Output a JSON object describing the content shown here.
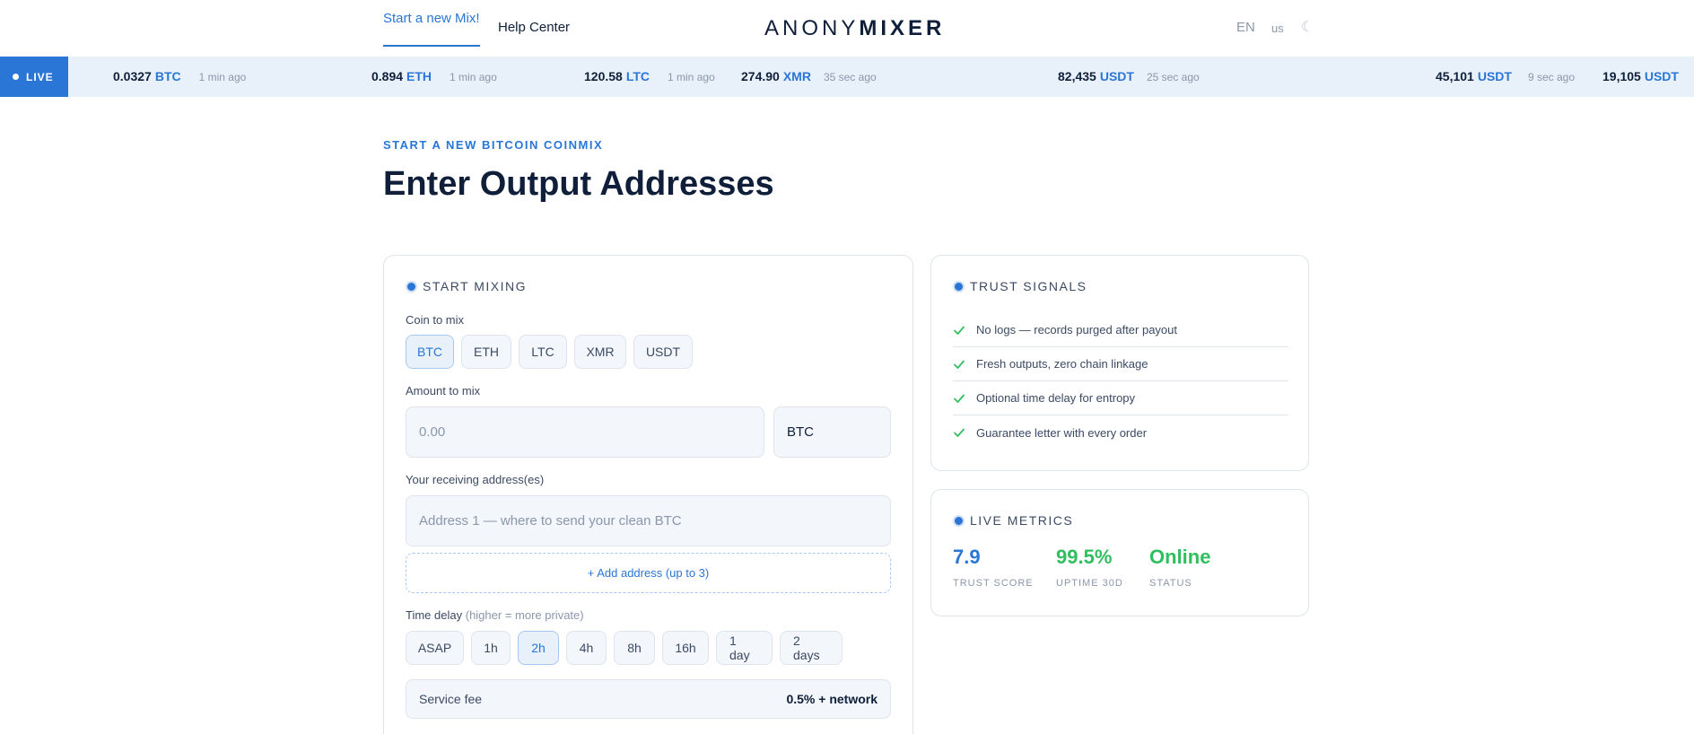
{
  "header": {
    "nav_active": "Start a new Mix!",
    "nav_help": "Help Center",
    "brand_light": "ANONY",
    "brand_bold": "MIXER",
    "lang": "EN",
    "region": "us",
    "theme_icon": "moon-icon",
    "theme_glyph": "☾"
  },
  "ticker": {
    "badge": "LIVE",
    "items": [
      {
        "amount": "0.0327",
        "coin": "BTC",
        "ago": "1 min ago"
      },
      {
        "amount": "0.894",
        "coin": "ETH",
        "ago": "1 min ago"
      },
      {
        "amount": "120.58",
        "coin": "LTC",
        "ago": "1 min ago"
      },
      {
        "amount": "274.90",
        "coin": "XMR",
        "ago": "35 sec ago"
      },
      {
        "amount": "82,435",
        "coin": "USDT",
        "ago": "25 sec ago"
      },
      {
        "amount": "45,101",
        "coin": "USDT",
        "ago": "9 sec ago"
      },
      {
        "amount": "19,105",
        "coin": "USDT",
        "ago": ""
      }
    ]
  },
  "page": {
    "eyebrow": "START A NEW BITCOIN COINMIX",
    "title": "Enter Output Addresses"
  },
  "mix_form": {
    "heading": "START MIXING",
    "coin_label": "Coin to mix",
    "coins": [
      "BTC",
      "ETH",
      "LTC",
      "XMR",
      "USDT"
    ],
    "selected_coin": "BTC",
    "amount_label": "Amount to mix",
    "amount_placeholder": "0.00",
    "amount_unit": "BTC",
    "address_label": "Your receiving address(es)",
    "address_placeholder": "Address 1 — where to send your clean BTC",
    "add_address": "+ Add address (up to 3)",
    "delay_label": "Time delay",
    "delay_hint": "(higher = more private)",
    "delays": [
      "ASAP",
      "1h",
      "2h",
      "4h",
      "8h",
      "16h",
      "1 day",
      "2 days"
    ],
    "selected_delay": "2h",
    "fee_label": "Service fee",
    "fee_value": "0.5% + network"
  },
  "trust": {
    "heading": "TRUST SIGNALS",
    "items": [
      "No logs — records purged after payout",
      "Fresh outputs, zero chain linkage",
      "Optional time delay for entropy",
      "Guarantee letter with every order"
    ]
  },
  "metrics": {
    "heading": "LIVE METRICS",
    "items": [
      {
        "value": "7.9",
        "label": "TRUST SCORE",
        "color": "#2a76d6"
      },
      {
        "value": "99.5%",
        "label": "UPTIME 30D",
        "color": "#2fbf5e"
      },
      {
        "value": "Online",
        "label": "STATUS",
        "color": "#2fbf5e"
      }
    ]
  },
  "colors": {
    "accent": "#2a76d6",
    "success": "#2fbf5e"
  }
}
